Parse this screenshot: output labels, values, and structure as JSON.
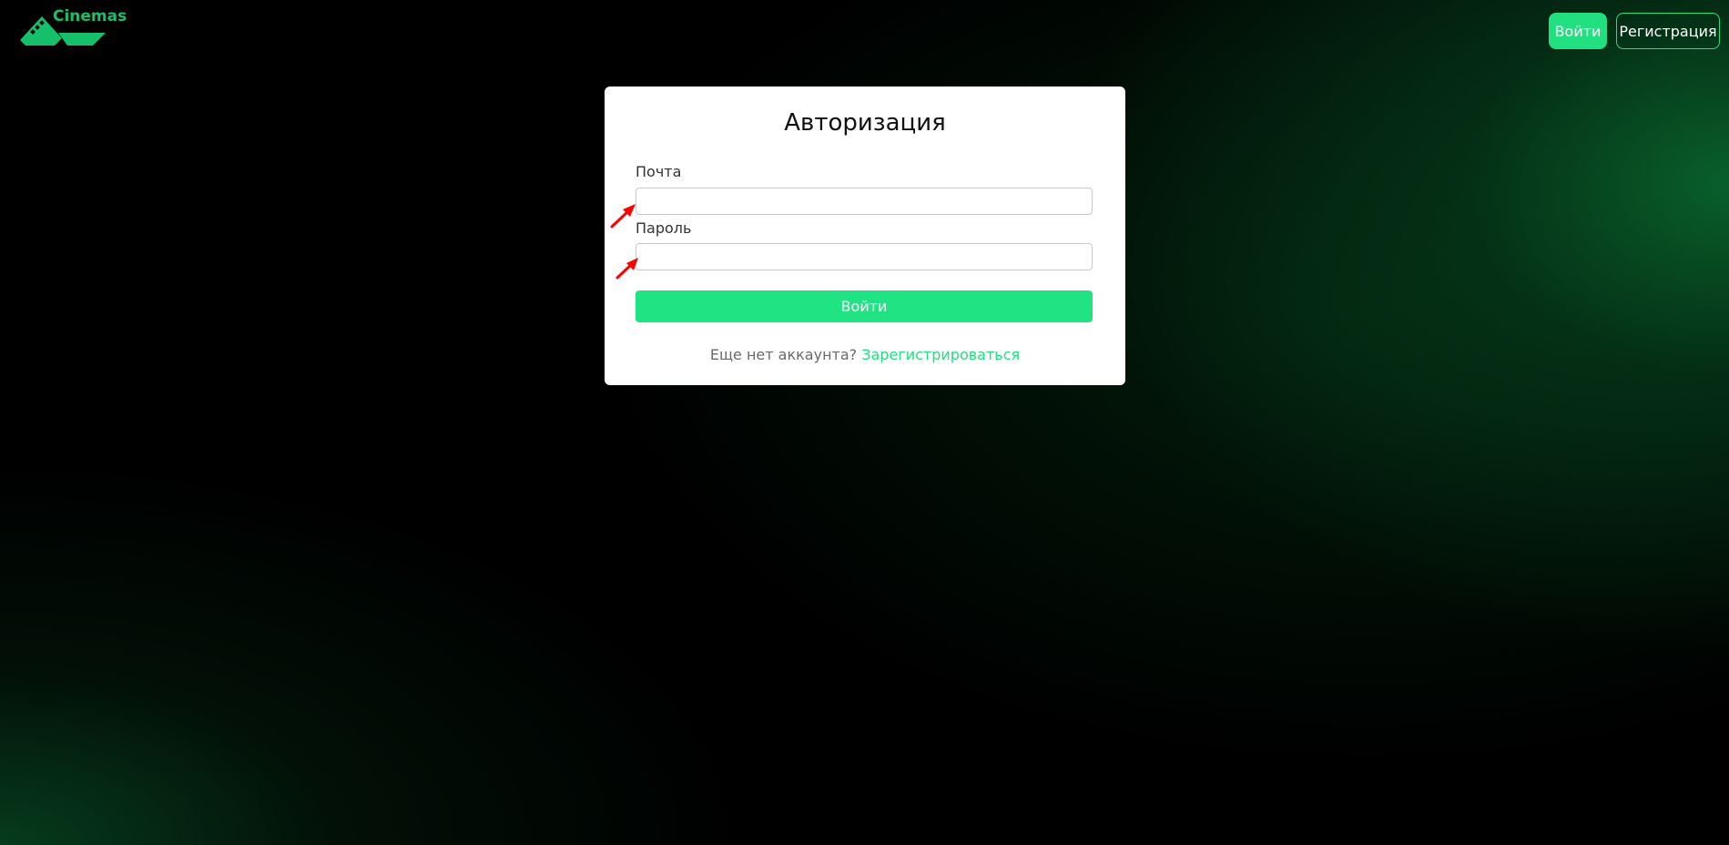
{
  "brand": {
    "name": "Cinemas",
    "color": "#16c06a"
  },
  "header": {
    "login_label": "Войти",
    "register_label": "Регистрация"
  },
  "auth_form": {
    "title": "Авторизация",
    "email": {
      "label": "Почта",
      "value": "",
      "placeholder": ""
    },
    "password": {
      "label": "Пароль",
      "value": "",
      "placeholder": ""
    },
    "submit_label": "Войти",
    "footer_text": "Еще нет аккаунта?",
    "register_link_label": "Зарегистрироваться"
  },
  "colors": {
    "accent": "#20e07f",
    "card_bg": "#ffffff",
    "page_bg": "#000000",
    "annotation_arrow": "#ff0000"
  },
  "icons": {
    "logo": "film-strip-logo-icon",
    "annotations": [
      "red-arrow-icon",
      "red-arrow-icon"
    ]
  }
}
